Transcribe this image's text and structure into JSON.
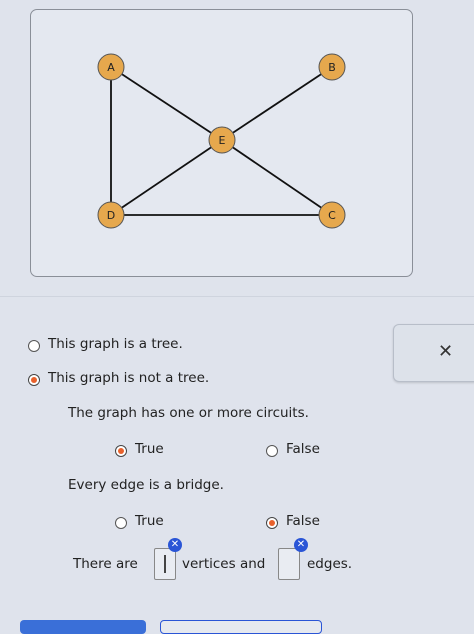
{
  "graph": {
    "nodes": [
      "A",
      "B",
      "E",
      "D",
      "C"
    ],
    "edges": [
      [
        "A",
        "E"
      ],
      [
        "B",
        "E"
      ],
      [
        "E",
        "C"
      ],
      [
        "E",
        "D"
      ],
      [
        "A",
        "D"
      ],
      [
        "D",
        "C"
      ]
    ]
  },
  "options": {
    "tree_label": "This graph is a tree.",
    "not_tree_label": "This graph is not a tree.",
    "circuits_statement": "The graph has one or more circuits.",
    "circuits_true": "True",
    "circuits_false": "False",
    "bridge_statement": "Every edge is a bridge.",
    "bridge_true": "True",
    "bridge_false": "False"
  },
  "answer": {
    "prefix": "There are",
    "middle": "vertices and",
    "suffix": "edges.",
    "vertices_value": "",
    "edges_value": ""
  },
  "close_icon": "✕",
  "selected": {
    "tree": "not_tree",
    "circuits": "true",
    "bridge": "false"
  },
  "colors": {
    "node_fill": "#e6a84d",
    "selected_radio": "#e8612c",
    "badge": "#2a55d6"
  }
}
